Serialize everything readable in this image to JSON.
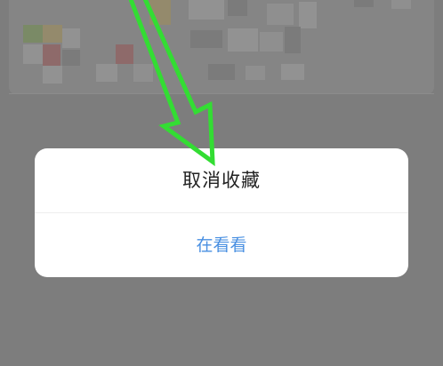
{
  "dialog": {
    "title": "取消收藏",
    "action_label": "在看看"
  },
  "colors": {
    "overlay": "#7d7d7d",
    "dialog_bg": "#ffffff",
    "title_text": "#222222",
    "action_text": "#4a90e2",
    "annotation_arrow": "#33dd33"
  },
  "icons": {
    "annotation": "green-arrow-pointing-down"
  }
}
